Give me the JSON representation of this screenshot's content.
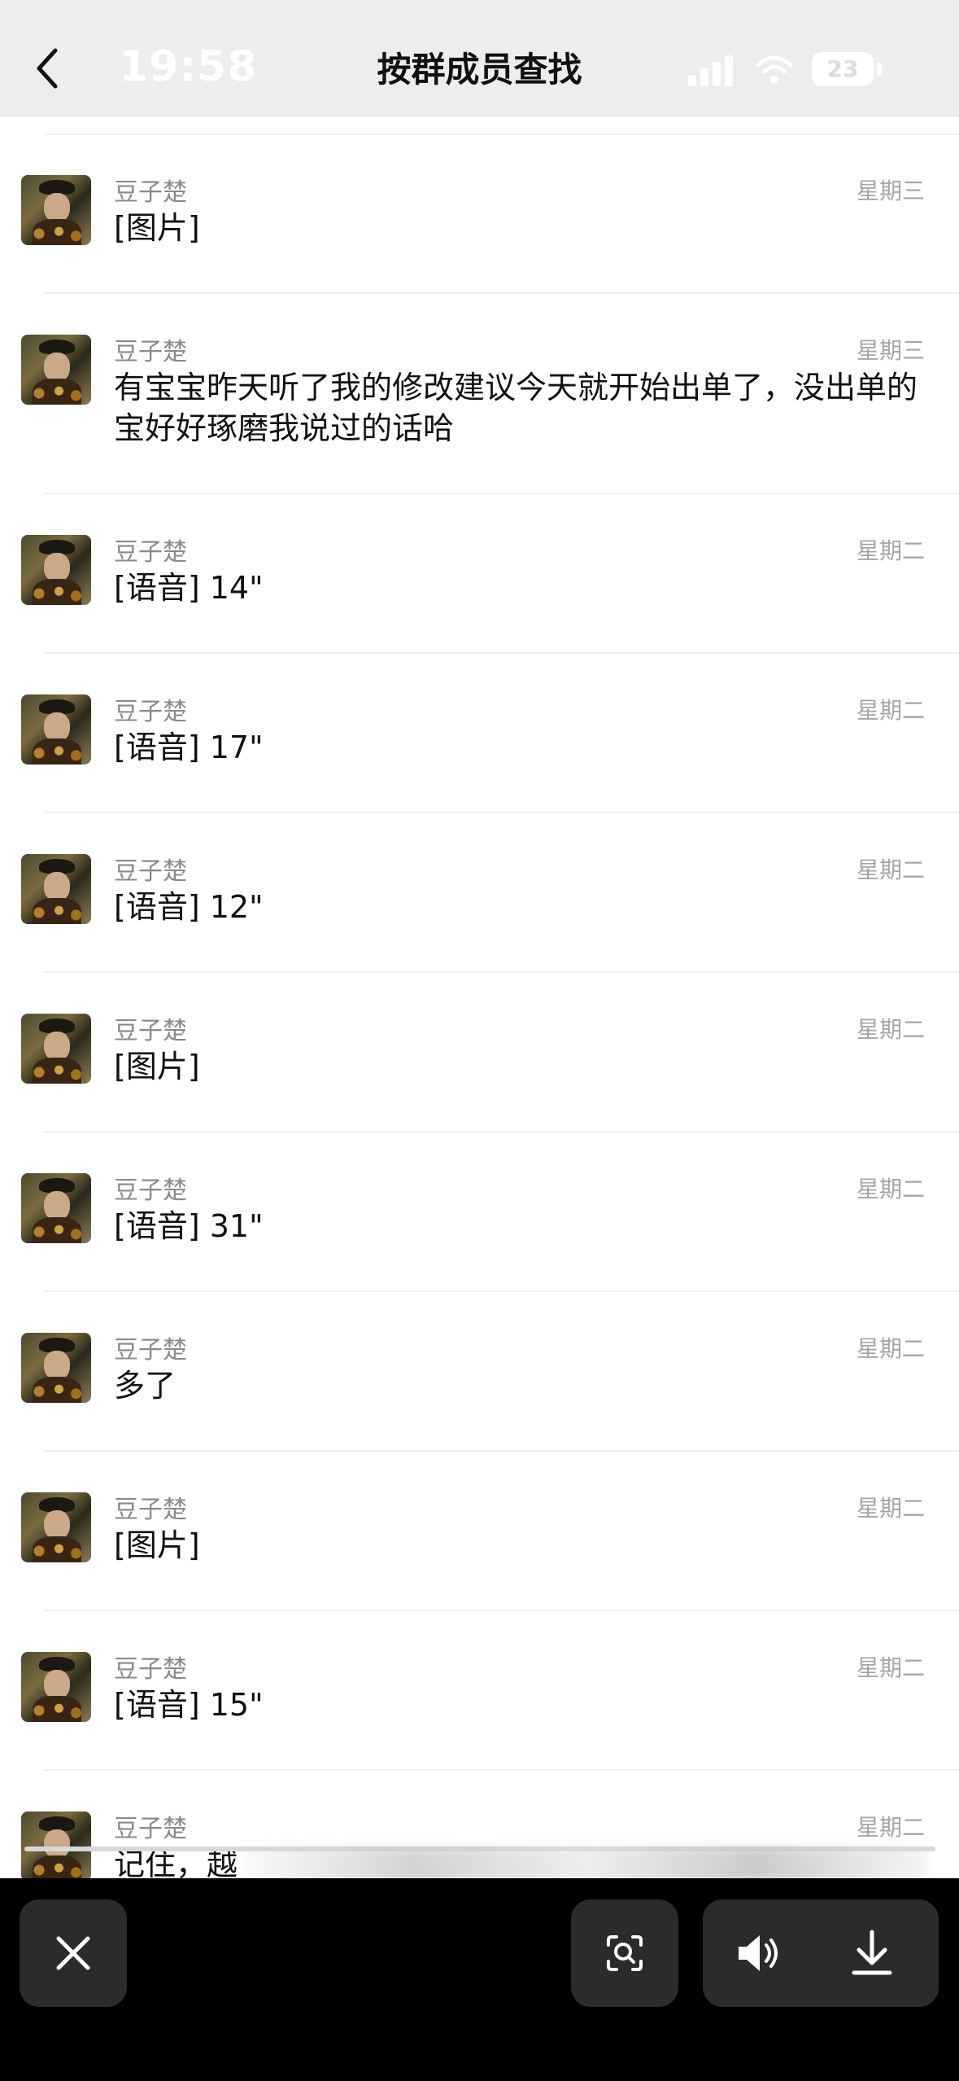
{
  "status_bar": {
    "time": "19:58",
    "battery": "23"
  },
  "header": {
    "title": "按群成员查找"
  },
  "messages": [
    {
      "sender": "豆子楚",
      "time": "星期三",
      "content": "[图片]"
    },
    {
      "sender": "豆子楚",
      "time": "星期三",
      "content": "有宝宝昨天听了我的修改建议今天就开始出单了，没出单的宝好好琢磨我说过的话哈"
    },
    {
      "sender": "豆子楚",
      "time": "星期二",
      "content": "[语音] 14\""
    },
    {
      "sender": "豆子楚",
      "time": "星期二",
      "content": "[语音] 17\""
    },
    {
      "sender": "豆子楚",
      "time": "星期二",
      "content": "[语音] 12\""
    },
    {
      "sender": "豆子楚",
      "time": "星期二",
      "content": "[图片]"
    },
    {
      "sender": "豆子楚",
      "time": "星期二",
      "content": "[语音] 31\""
    },
    {
      "sender": "豆子楚",
      "time": "星期二",
      "content": "多了"
    },
    {
      "sender": "豆子楚",
      "time": "星期二",
      "content": "[图片]"
    },
    {
      "sender": "豆子楚",
      "time": "星期二",
      "content": "[语音] 15\""
    },
    {
      "sender": "豆子楚",
      "time": "星期二",
      "content": "记住，越"
    }
  ],
  "toolbar": {
    "close": "close-icon",
    "lens": "image-search-icon",
    "speaker": "speaker-icon",
    "download": "download-icon"
  }
}
